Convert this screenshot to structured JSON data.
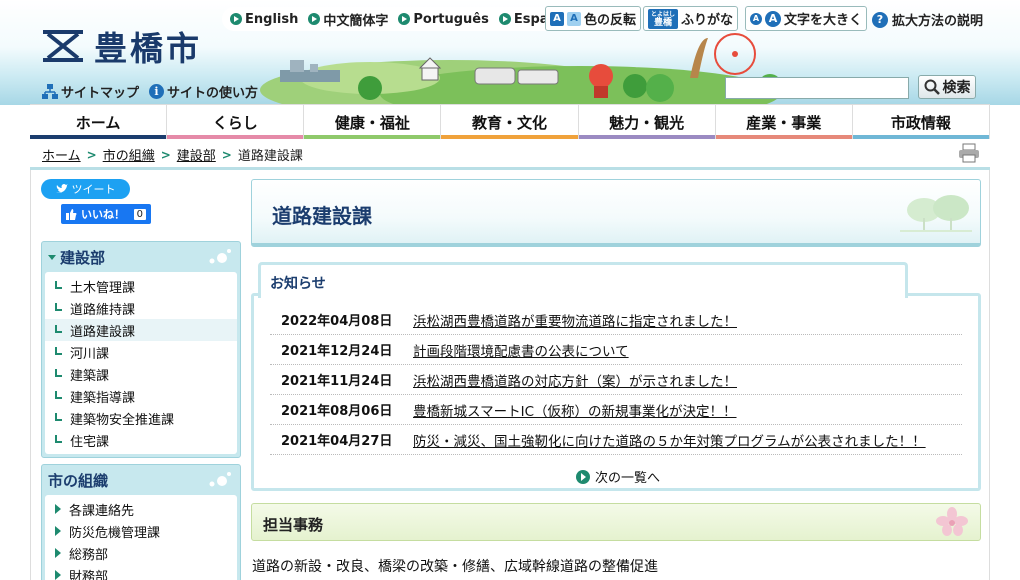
{
  "header": {
    "city_name": "豊橋市",
    "languages": [
      "English",
      "中文簡体字",
      "Português",
      "Español"
    ],
    "tools": {
      "color_invert": "色の反転",
      "furigana": "ふりがな",
      "furigana_badge_top": "とよはし",
      "furigana_badge_bottom": "豊橋",
      "text_size": "文字を大きく",
      "zoom_help": "拡大方法の説明"
    },
    "sitemap": "サイトマップ",
    "site_usage": "サイトの使い方",
    "search_placeholder": "",
    "search_button": "検索"
  },
  "nav": {
    "items": [
      {
        "label": "ホーム",
        "color": "#1b3d6e"
      },
      {
        "label": "くらし",
        "color": "#e58aa8"
      },
      {
        "label": "健康・福祉",
        "color": "#8fc96b"
      },
      {
        "label": "教育・文化",
        "color": "#f0a23b"
      },
      {
        "label": "魅力・観光",
        "color": "#9b8ac2"
      },
      {
        "label": "産業・事業",
        "color": "#e6897a"
      },
      {
        "label": "市政情報",
        "color": "#6fb7d6"
      }
    ]
  },
  "breadcrumb": [
    "ホーム",
    "市の組織",
    "建設部",
    "道路建設課"
  ],
  "social": {
    "tweet": "ツイート",
    "like": "いいね！",
    "like_count": "0"
  },
  "sidebar": {
    "dept": {
      "title": "建設部",
      "items": [
        "土木管理課",
        "道路維持課",
        "道路建設課",
        "河川課",
        "建築課",
        "建築指導課",
        "建築物安全推進課",
        "住宅課"
      ],
      "active_index": 2
    },
    "org": {
      "title": "市の組織",
      "items": [
        "各課連絡先",
        "防災危機管理課",
        "総務部",
        "財務部"
      ]
    }
  },
  "main": {
    "title": "道路建設課",
    "news_heading": "お知らせ",
    "news": [
      {
        "date": "2022年04月08日",
        "title": "浜松湖西豊橋道路が重要物流道路に指定されました！"
      },
      {
        "date": "2021年12月24日",
        "title": "計画段階環境配慮書の公表について"
      },
      {
        "date": "2021年11月24日",
        "title": "浜松湖西豊橋道路の対応方針（案）が示されました！"
      },
      {
        "date": "2021年08月06日",
        "title": "豊橋新城スマートIC（仮称）の新規事業化が決定！！"
      },
      {
        "date": "2021年04月27日",
        "title": "防災・減災、国土強靭化に向けた道路の５か年対策プログラムが公表されました！！"
      }
    ],
    "more_link": "次の一覧へ",
    "duty_heading": "担当事務",
    "duty_text": "道路の新設・改良、橋梁の改築・修繕、広域幹線道路の整備促進"
  }
}
